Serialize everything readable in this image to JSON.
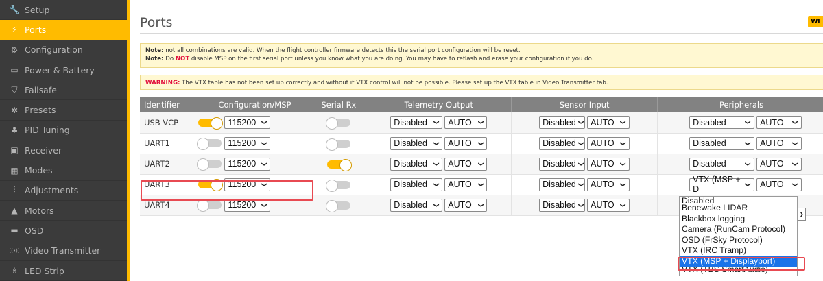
{
  "sidebar": {
    "items": [
      {
        "label": "Setup",
        "icon": "wrench-icon",
        "glyph": "🔧"
      },
      {
        "label": "Ports",
        "icon": "plug-icon",
        "glyph": "⚡"
      },
      {
        "label": "Configuration",
        "icon": "gear-icon",
        "glyph": "⚙"
      },
      {
        "label": "Power & Battery",
        "icon": "battery-icon",
        "glyph": "▭"
      },
      {
        "label": "Failsafe",
        "icon": "shield-icon",
        "glyph": "⛉"
      },
      {
        "label": "Presets",
        "icon": "presets-icon",
        "glyph": "✲"
      },
      {
        "label": "PID Tuning",
        "icon": "pid-icon",
        "glyph": "♣"
      },
      {
        "label": "Receiver",
        "icon": "receiver-icon",
        "glyph": "▣"
      },
      {
        "label": "Modes",
        "icon": "modes-icon",
        "glyph": "▦"
      },
      {
        "label": "Adjustments",
        "icon": "sliders-icon",
        "glyph": "⫶"
      },
      {
        "label": "Motors",
        "icon": "motor-icon",
        "glyph": "▲"
      },
      {
        "label": "OSD",
        "icon": "osd-icon",
        "glyph": "▬"
      },
      {
        "label": "Video Transmitter",
        "icon": "vtx-icon",
        "glyph": "((•))"
      },
      {
        "label": "LED Strip",
        "icon": "led-icon",
        "glyph": "♗"
      }
    ],
    "active_index": 1,
    "active_color": "#ffbb00"
  },
  "header": {
    "title": "Ports",
    "button_label": "WI"
  },
  "notes": {
    "line1_prefix": "Note:",
    "line1_text": " not all combinations are valid. When the flight controller firmware detects this the serial port configuration will be reset.",
    "line2_prefix": "Note:",
    "line2_mid1": " Do ",
    "line2_not": "NOT",
    "line2_text": " disable MSP on the first serial port unless you know what you are doing. You may have to reflash and erase your configuration if you do."
  },
  "warning": {
    "prefix": "WARNING:",
    "text": " The VTX table has not been set up correctly and without it VTX control will not be possible. Please set up the VTX table in Video Transmitter tab."
  },
  "table": {
    "headers": [
      "Identifier",
      "Configuration/MSP",
      "Serial Rx",
      "Telemetry Output",
      "Sensor Input",
      "Peripherals"
    ],
    "rows": [
      {
        "id": "USB VCP",
        "msp_on": true,
        "baud": "115200",
        "rx_on": false,
        "tele": "Disabled",
        "tele_baud": "AUTO",
        "sensor": "Disabled",
        "sensor_baud": "AUTO",
        "peri": "Disabled",
        "peri_baud": "AUTO"
      },
      {
        "id": "UART1",
        "msp_on": false,
        "baud": "115200",
        "rx_on": false,
        "tele": "Disabled",
        "tele_baud": "AUTO",
        "sensor": "Disabled",
        "sensor_baud": "AUTO",
        "peri": "Disabled",
        "peri_baud": "AUTO"
      },
      {
        "id": "UART2",
        "msp_on": false,
        "baud": "115200",
        "rx_on": true,
        "tele": "Disabled",
        "tele_baud": "AUTO",
        "sensor": "Disabled",
        "sensor_baud": "AUTO",
        "peri": "Disabled",
        "peri_baud": "AUTO"
      },
      {
        "id": "UART3",
        "msp_on": true,
        "baud": "115200",
        "rx_on": false,
        "tele": "Disabled",
        "tele_baud": "AUTO",
        "sensor": "Disabled",
        "sensor_baud": "AUTO",
        "peri": "VTX (MSP + D",
        "peri_baud": "AUTO"
      },
      {
        "id": "UART4",
        "msp_on": false,
        "baud": "115200",
        "rx_on": false,
        "tele": "Disabled",
        "tele_baud": "AUTO",
        "sensor": "Disabled",
        "sensor_baud": "AUTO",
        "peri": "",
        "peri_baud": ""
      }
    ]
  },
  "dropdown": {
    "options": [
      "Disabled",
      "Benewake LIDAR",
      "Blackbox logging",
      "Camera (RunCam Protocol)",
      "OSD (FrSky Protocol)",
      "VTX (IRC Tramp)",
      "VTX (MSP + Displayport)",
      "VTX (TBS SmartAudio)"
    ],
    "selected_index": 6,
    "selected_color": "#1a73e8"
  },
  "colors": {
    "accent": "#ffbb00",
    "highlight": "#e84a52",
    "warning_text": "#e2123f"
  }
}
